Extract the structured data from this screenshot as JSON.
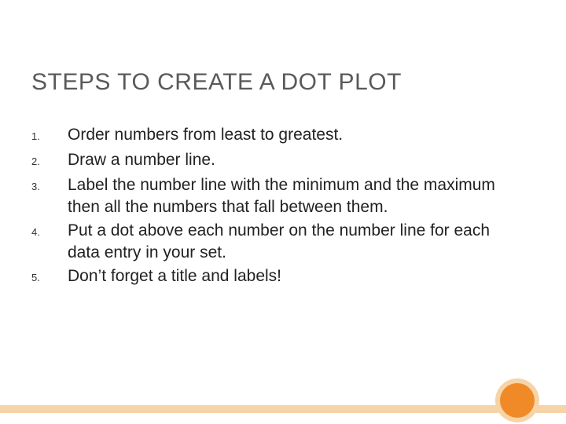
{
  "title": "STEPS TO CREATE A DOT PLOT",
  "items": [
    {
      "num": "1.",
      "text": "Order numbers from least to greatest."
    },
    {
      "num": "2.",
      "text": "Draw a number line."
    },
    {
      "num": "3.",
      "text": "Label the number line with the minimum and the maximum then all the numbers that fall between them."
    },
    {
      "num": "4.",
      "text": "Put a dot above each number on the number line for each data entry in your set."
    },
    {
      "num": "5.",
      "text": "Don’t forget a title and labels!"
    }
  ]
}
